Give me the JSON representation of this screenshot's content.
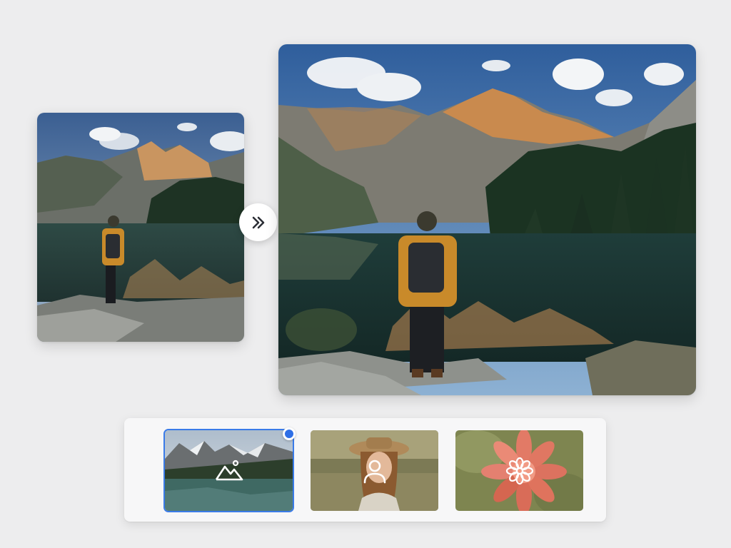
{
  "editor": {
    "before_image": {
      "alt": "",
      "subject": "hiker-at-mountain-lake"
    },
    "after_image": {
      "alt": "",
      "subject": "hiker-at-mountain-lake-enhanced"
    },
    "transform_button": {
      "icon": "double-chevron-right-icon",
      "label": ""
    }
  },
  "style_picker": {
    "selected_index": 0,
    "options": [
      {
        "id": "landscape",
        "icon": "mountain-icon",
        "selected": true
      },
      {
        "id": "portrait",
        "icon": "person-icon",
        "selected": false
      },
      {
        "id": "flower",
        "icon": "flower-icon",
        "selected": false
      }
    ]
  },
  "colors": {
    "accent": "#2f6fe6",
    "background": "#ededee",
    "panel": "#f7f7f8"
  }
}
